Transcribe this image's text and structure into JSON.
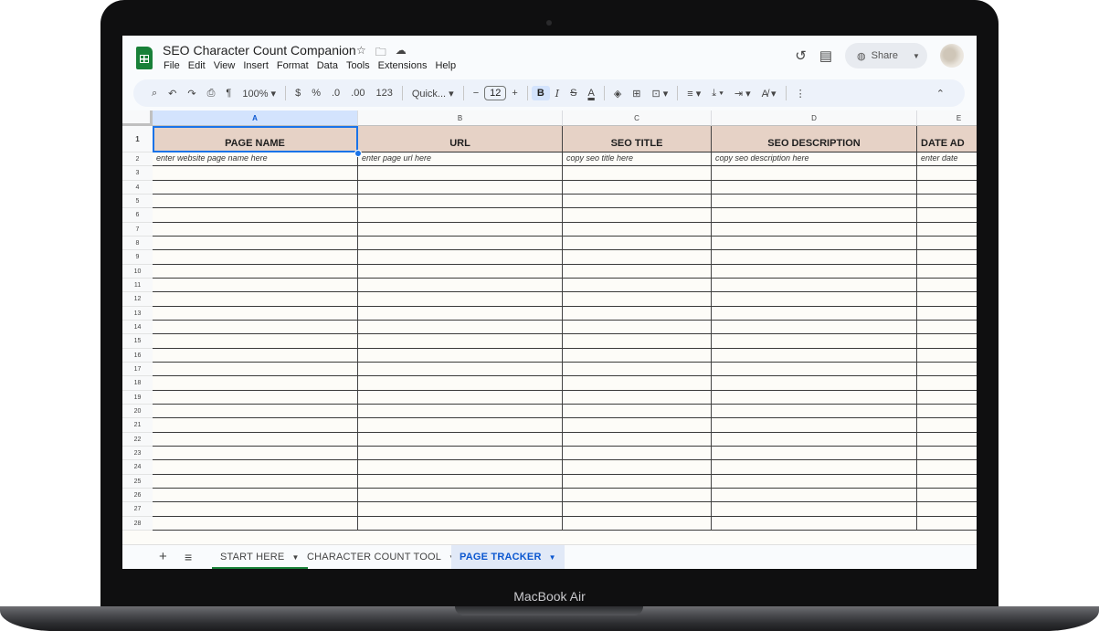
{
  "device": {
    "brand": "MacBook Air"
  },
  "doc": {
    "title": "SEO Character Count Companion"
  },
  "menu": [
    "File",
    "Edit",
    "View",
    "Insert",
    "Format",
    "Data",
    "Tools",
    "Extensions",
    "Help"
  ],
  "header": {
    "share_label": "Share"
  },
  "toolbar": {
    "zoom": "100%",
    "currency": "$",
    "percent": "%",
    "dec_decrease": ".0",
    "dec_increase": ".00",
    "number_format": "123",
    "font": "Quick...",
    "font_size": "12",
    "bold": "B",
    "italic": "I",
    "text_color": "A"
  },
  "columns": [
    {
      "letter": "A",
      "header": "PAGE NAME",
      "placeholder": "enter website page name here"
    },
    {
      "letter": "B",
      "header": "URL",
      "placeholder": "enter page url here"
    },
    {
      "letter": "C",
      "header": "SEO TITLE",
      "placeholder": "copy seo title here"
    },
    {
      "letter": "D",
      "header": "SEO DESCRIPTION",
      "placeholder": "copy seo description here"
    },
    {
      "letter": "E",
      "header": "DATE AD",
      "placeholder": "enter date"
    }
  ],
  "rows": [
    "1",
    "2",
    "3",
    "4",
    "5",
    "6",
    "7",
    "8",
    "9",
    "10",
    "11",
    "12",
    "13",
    "14",
    "15",
    "16",
    "17",
    "18",
    "19",
    "20",
    "21",
    "22",
    "23",
    "24",
    "25",
    "26",
    "27",
    "28"
  ],
  "tabs": [
    {
      "label": "START HERE",
      "active": false,
      "underline": true
    },
    {
      "label": "CHARACTER COUNT TOOL",
      "active": false,
      "underline": false
    },
    {
      "label": "PAGE TRACKER",
      "active": true,
      "underline": false
    }
  ],
  "colors": {
    "header_fill": "#e6d2c6",
    "accent": "#0b57d0",
    "sheets_green": "#188038"
  }
}
